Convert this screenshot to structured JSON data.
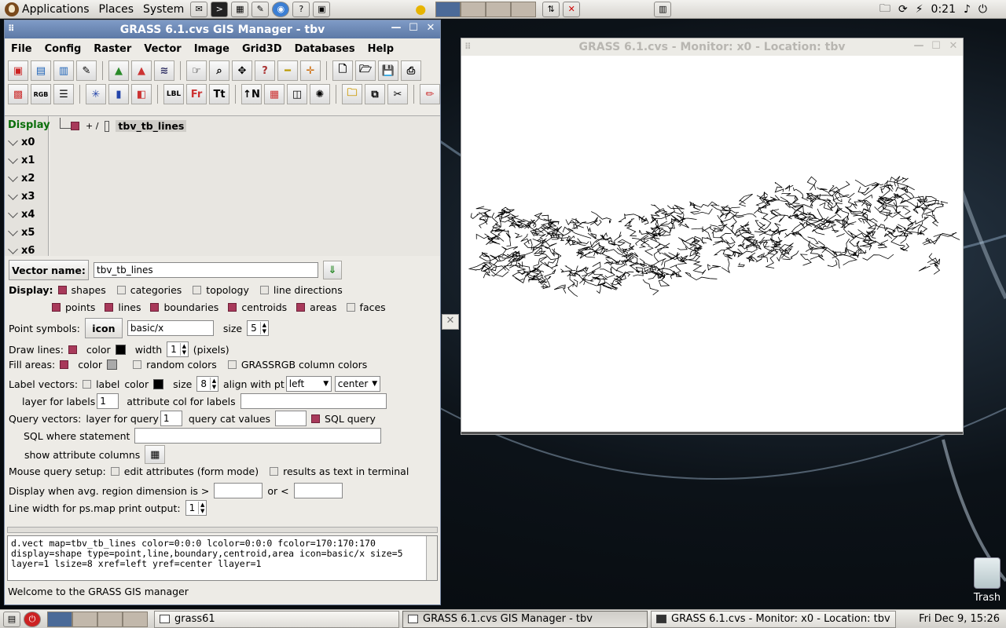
{
  "top_panel": {
    "menus": [
      "Applications",
      "Places",
      "System"
    ],
    "clock": "0:21"
  },
  "bottom_panel": {
    "tasks": [
      "grass61",
      "GRASS 6.1.cvs GIS Manager - tbv",
      "GRASS 6.1.cvs - Monitor: x0 - Location: tbv"
    ],
    "clock": "Fri Dec  9, 15:26"
  },
  "manager": {
    "title": "GRASS 6.1.cvs GIS Manager - tbv",
    "menus": [
      "File",
      "Config",
      "Raster",
      "Vector",
      "Image",
      "Grid3D",
      "Databases",
      "Help"
    ],
    "display_label": "Display",
    "monitors": [
      "x0",
      "x1",
      "x2",
      "x3",
      "x4",
      "x5",
      "x6"
    ],
    "layer_name": "tbv_tb_lines",
    "options": {
      "vector_name_btn": "Vector name:",
      "vector_name": "tbv_tb_lines",
      "display_label": "Display:",
      "shapes": "shapes",
      "categories": "categories",
      "topology": "topology",
      "line_directions": "line directions",
      "points": "points",
      "lines": "lines",
      "boundaries": "boundaries",
      "centroids": "centroids",
      "areas": "areas",
      "faces": "faces",
      "point_symbols": "Point symbols:",
      "icon_btn": "icon",
      "icon_value": "basic/x",
      "size_label": "size",
      "size_value": "5",
      "draw_lines": "Draw lines:",
      "color_label": "color",
      "width_label": "width",
      "width_value": "1",
      "pixels": "(pixels)",
      "fill_areas": "Fill areas:",
      "random_colors": "random colors",
      "grassrgb": "GRASSRGB column colors",
      "label_vectors": "Label vectors:",
      "label": "label",
      "label_size": "8",
      "align": "align with pt",
      "align_h": "left",
      "align_v": "center",
      "layer_for_labels": "layer for labels",
      "layer_value": "1",
      "attr_col": "attribute col for labels",
      "query_vectors": "Query vectors:",
      "layer_for_query": "layer for query",
      "query_layer": "1",
      "query_cat": "query cat values",
      "sql_query": "SQL query",
      "sql_where": "SQL where statement",
      "show_attr": "show attribute columns",
      "mouse_query": "Mouse query setup:",
      "edit_attr": "edit attributes (form mode)",
      "results_text": "results as text in terminal",
      "display_when": "Display when avg. region dimension is >",
      "or": "or <",
      "line_width_ps": "Line width for ps.map print output:",
      "ps_width": "1"
    },
    "command": "d.vect map=tbv_tb_lines color=0:0:0 lcolor=0:0:0 fcolor=170:170:170 display=shape type=point,line,boundary,centroid,area icon=basic/x size=5 layer=1 lsize=8 xref=left yref=center llayer=1",
    "status": "Welcome to the GRASS GIS manager"
  },
  "monitor": {
    "title": "GRASS 6.1.cvs - Monitor: x0 - Location: tbv"
  },
  "desktop": {
    "trash_label": "Trash"
  },
  "colors": {
    "title_active": "#6b88b4",
    "checkbox_on": "#a8395a",
    "label_green": "#0a6e0a"
  }
}
